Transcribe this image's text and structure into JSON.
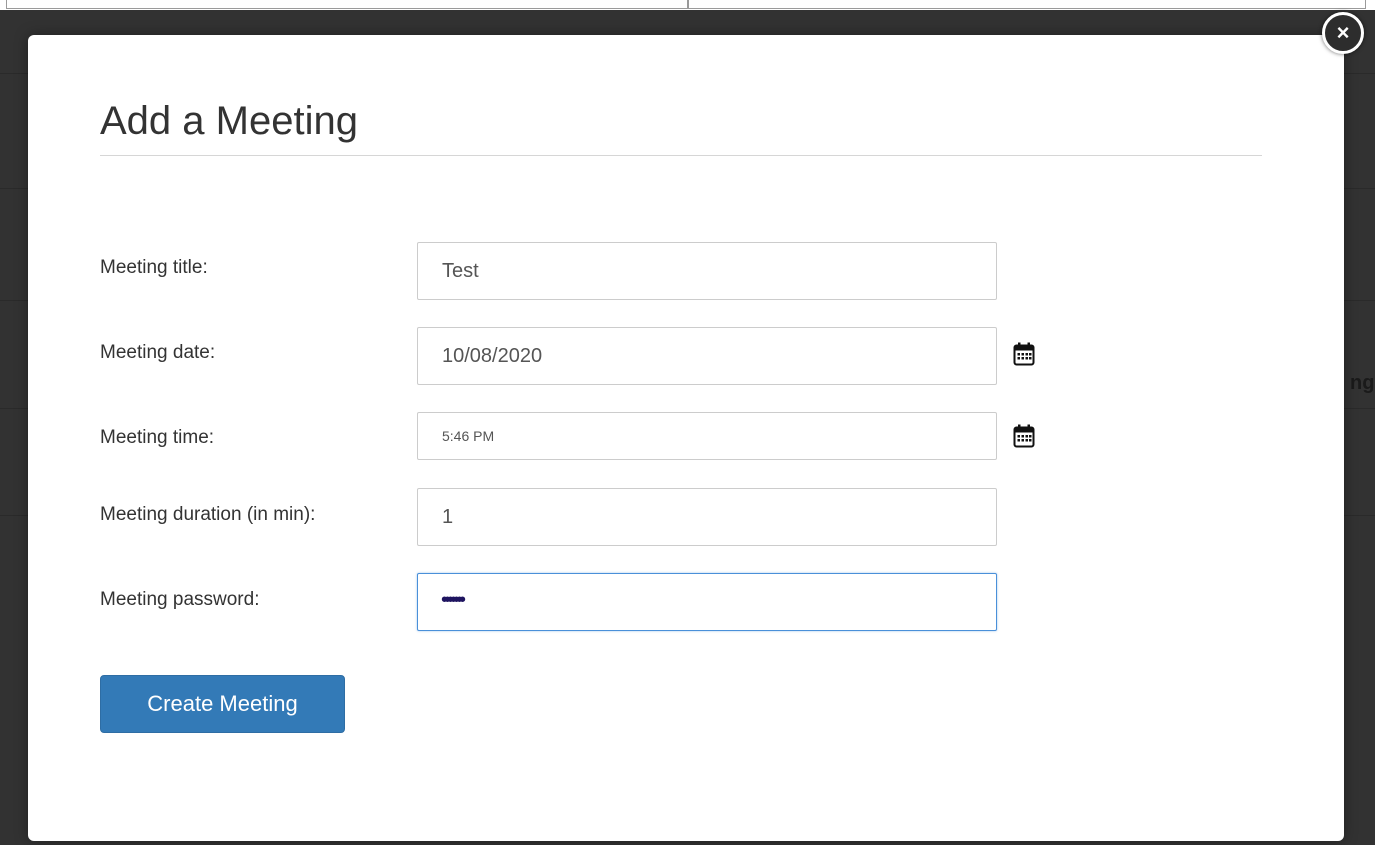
{
  "background": {
    "partial_text": "ng"
  },
  "modal": {
    "title": "Add a Meeting",
    "close_symbol": "×",
    "fields": {
      "title": {
        "label": "Meeting title:",
        "value": "Test"
      },
      "date": {
        "label": "Meeting date:",
        "value": "10/08/2020",
        "icon": "calendar-icon"
      },
      "time": {
        "label": "Meeting time:",
        "value": "5:46 PM",
        "icon": "calendar-icon"
      },
      "duration": {
        "label": "Meeting duration (in min):",
        "value": "1"
      },
      "password": {
        "label": "Meeting password:",
        "masked_value": "•••••••"
      }
    },
    "submit_label": "Create Meeting"
  },
  "colors": {
    "primary_button": "#337ab7",
    "overlay": "#323232",
    "focus_border": "#4a90d9"
  }
}
